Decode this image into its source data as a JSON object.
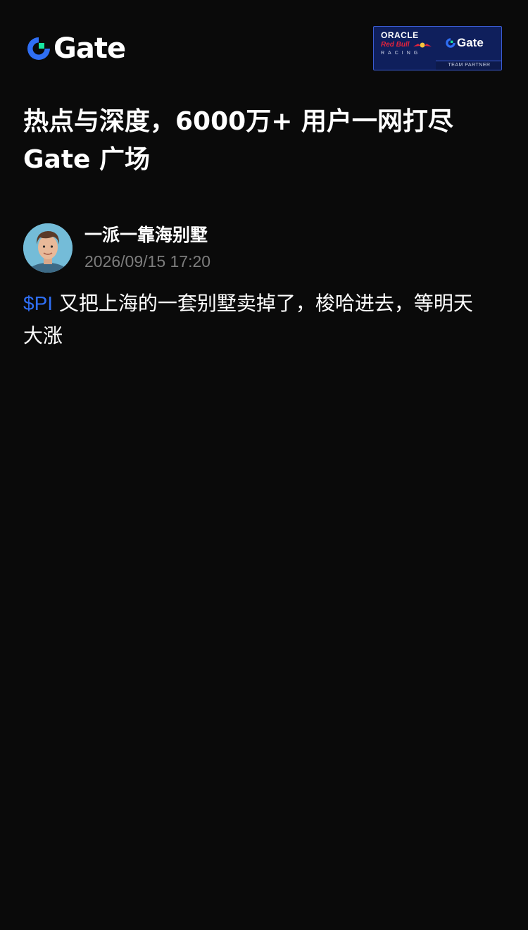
{
  "header": {
    "logo_text": "Gate",
    "partner": {
      "oracle": "ORACLE",
      "red_bull": "Red Bull",
      "racing": "RACING",
      "gate": "Gate",
      "team_partner": "TEAM PARTNER",
      "badge_color": "#0f1f5c"
    }
  },
  "headline": {
    "line1": "热点与深度，6000万+ 用户一网打尽",
    "line2": "Gate 广场"
  },
  "post": {
    "author_name": "一派一靠海别墅",
    "timestamp": "2026/09/15 17:20",
    "ticker": "$PI",
    "text_line1": " 又把上海的一套别墅卖掉了，梭哈进去，等明天",
    "text_line2": "大涨"
  },
  "colors": {
    "background": "#0a0a0a",
    "ticker_blue": "#2f6ff5",
    "brand_blue": "#2f6ff5",
    "brand_green": "#17e6a1",
    "muted_text": "#7d7d7d"
  }
}
